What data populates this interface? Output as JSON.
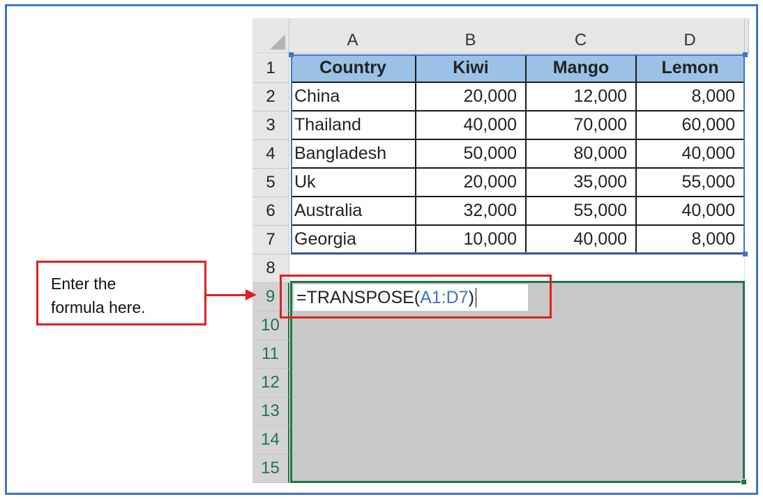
{
  "columns": [
    "A",
    "B",
    "C",
    "D"
  ],
  "rows": [
    "1",
    "2",
    "3",
    "4",
    "5",
    "6",
    "7",
    "8",
    "9",
    "10",
    "11",
    "12",
    "13",
    "14",
    "15"
  ],
  "table": {
    "headers": [
      "Country",
      "Kiwi",
      "Mango",
      "Lemon"
    ],
    "data": [
      [
        "China",
        "20,000",
        "12,000",
        "8,000"
      ],
      [
        "Thailand",
        "40,000",
        "70,000",
        "60,000"
      ],
      [
        "Bangladesh",
        "50,000",
        "80,000",
        "40,000"
      ],
      [
        "Uk",
        "20,000",
        "35,000",
        "55,000"
      ],
      [
        "Australia",
        "32,000",
        "55,000",
        "40,000"
      ],
      [
        "Georgia",
        "10,000",
        "40,000",
        "8,000"
      ]
    ]
  },
  "formula": {
    "prefix": "=TRANSPOSE(",
    "reference": "A1:D7",
    "suffix": ")"
  },
  "callout": {
    "line1": "Enter the",
    "line2": "formula here."
  },
  "colors": {
    "frame": "#4472c4",
    "table_header_fill": "#9bc2e6",
    "selection_green": "#217346",
    "annotation_red": "#e02020",
    "range_fill": "#c8c8c8"
  }
}
